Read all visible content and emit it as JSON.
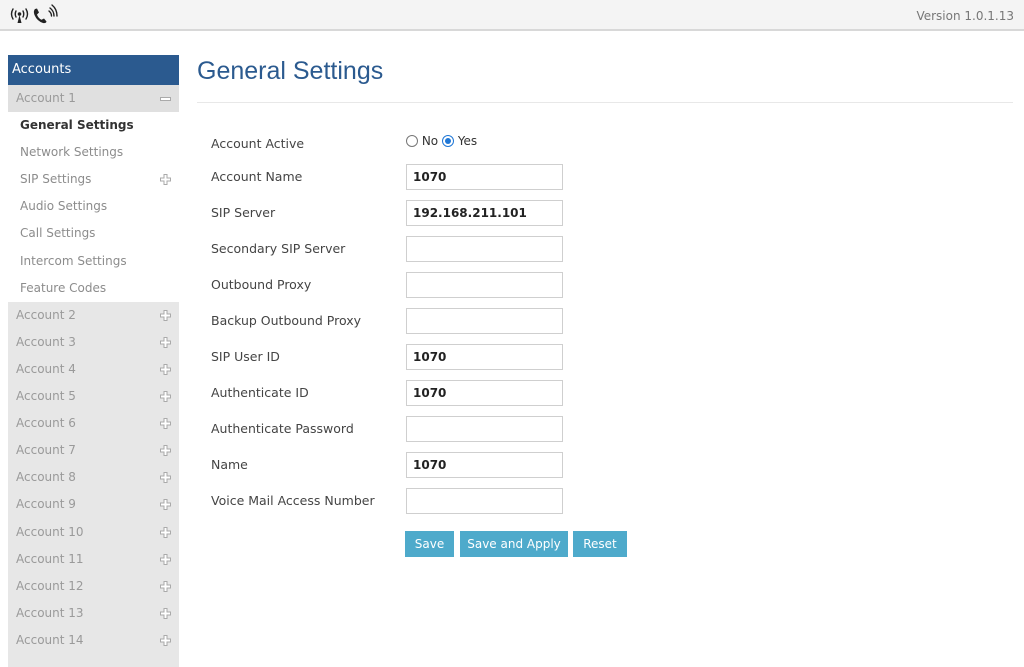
{
  "header": {
    "version": "Version 1.0.1.13",
    "logo": "wifi-phone-logo-icon"
  },
  "sidebar": {
    "title": "Accounts",
    "account1": {
      "label": "Account 1",
      "icon": "minus-icon"
    },
    "subitems": [
      {
        "label": "General Settings",
        "active": true
      },
      {
        "label": "Network Settings"
      },
      {
        "label": "SIP Settings",
        "icon": "plus-icon"
      },
      {
        "label": "Audio Settings"
      },
      {
        "label": "Call Settings"
      },
      {
        "label": "Intercom Settings"
      },
      {
        "label": "Feature Codes"
      }
    ],
    "accounts": [
      {
        "label": "Account 2"
      },
      {
        "label": "Account 3"
      },
      {
        "label": "Account 4"
      },
      {
        "label": "Account 5"
      },
      {
        "label": "Account 6"
      },
      {
        "label": "Account 7"
      },
      {
        "label": "Account 8"
      },
      {
        "label": "Account 9"
      },
      {
        "label": "Account 10"
      },
      {
        "label": "Account 11"
      },
      {
        "label": "Account 12"
      },
      {
        "label": "Account 13"
      },
      {
        "label": "Account 14"
      }
    ]
  },
  "main": {
    "title": "General Settings",
    "account_active": {
      "label": "Account Active",
      "no_label": "No",
      "yes_label": "Yes",
      "selected": "Yes"
    },
    "fields": [
      {
        "label": "Account Name",
        "value": "1070"
      },
      {
        "label": "SIP Server",
        "value": "192.168.211.101"
      },
      {
        "label": "Secondary SIP Server",
        "value": ""
      },
      {
        "label": "Outbound Proxy",
        "value": ""
      },
      {
        "label": "Backup Outbound Proxy",
        "value": ""
      },
      {
        "label": "SIP User ID",
        "value": "1070"
      },
      {
        "label": "Authenticate ID",
        "value": "1070"
      },
      {
        "label": "Authenticate Password",
        "value": ""
      },
      {
        "label": "Name",
        "value": "1070"
      },
      {
        "label": "Voice Mail Access Number",
        "value": ""
      }
    ],
    "buttons": {
      "save": "Save",
      "save_apply": "Save and Apply",
      "reset": "Reset"
    }
  },
  "colors": {
    "brand_blue": "#2b5a8f",
    "button_blue": "#4eaacb",
    "sidebar_bg": "#e7e7e7"
  }
}
